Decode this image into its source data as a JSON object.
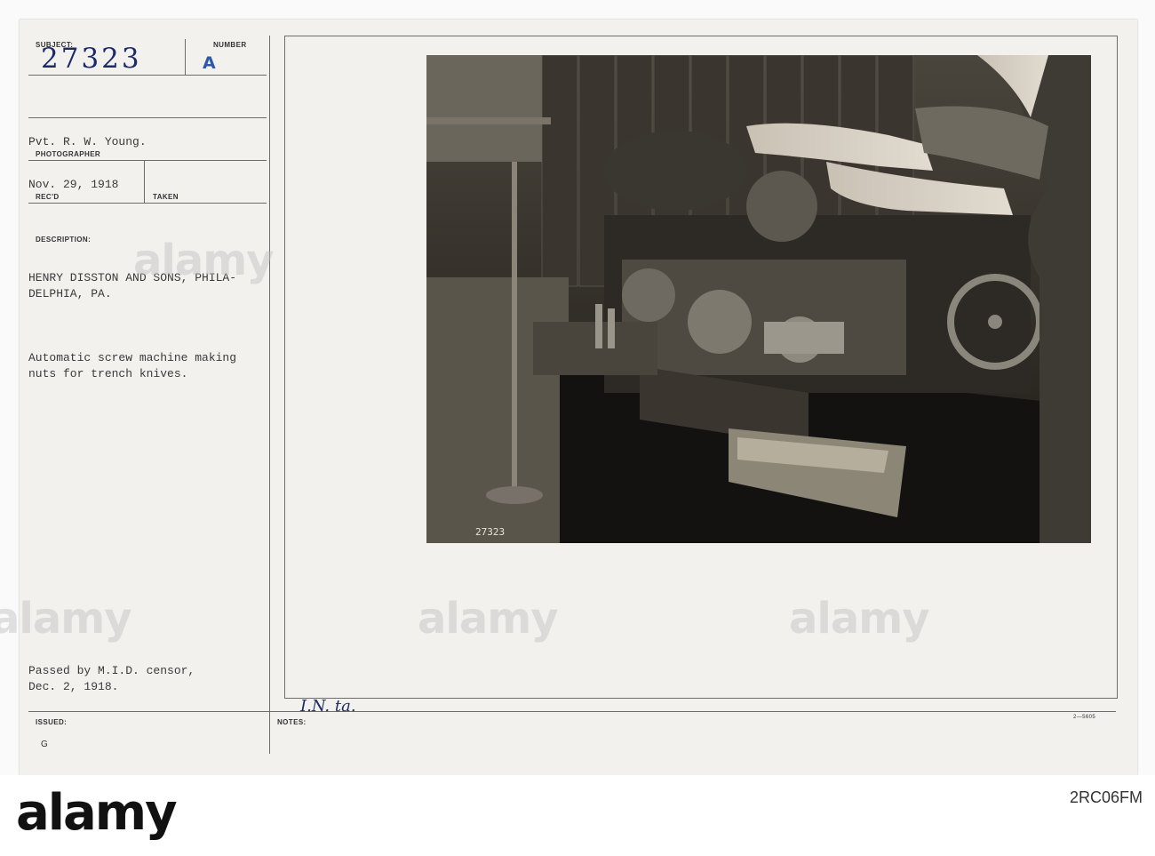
{
  "card": {
    "subject_label": "SUBJECT:",
    "number_label": "NUMBER",
    "subject_number": "27323",
    "number_value": "A",
    "photographer_name": "Pvt. R. W. Young.",
    "photographer_label": "PHOTOGRAPHER",
    "recd_date": "Nov. 29, 1918",
    "recd_label": "REC'D",
    "taken_label": "TAKEN",
    "description_label": "DESCRIPTION:",
    "description_lines": [
      "HENRY DISSTON AND SONS, PHILA-",
      "DELPHIA, PA.",
      "Automatic screw machine making",
      "nuts for trench knives."
    ],
    "censor_lines": [
      "Passed by M.I.D. censor,",
      "Dec. 2, 1918."
    ],
    "issued_label": "ISSUED:",
    "issued_value": "G",
    "notes_label": "NOTES:",
    "notes_handwriting": "I.N. ta.",
    "form_code": "2—5605",
    "photo_caption": "27323"
  },
  "watermark": {
    "brand": "alamy",
    "image_id": "2RC06FM"
  },
  "colors": {
    "card": "#f2f1ee",
    "ink_stamp": "#2c59a8",
    "ink_hand": "#1c2a6a"
  }
}
